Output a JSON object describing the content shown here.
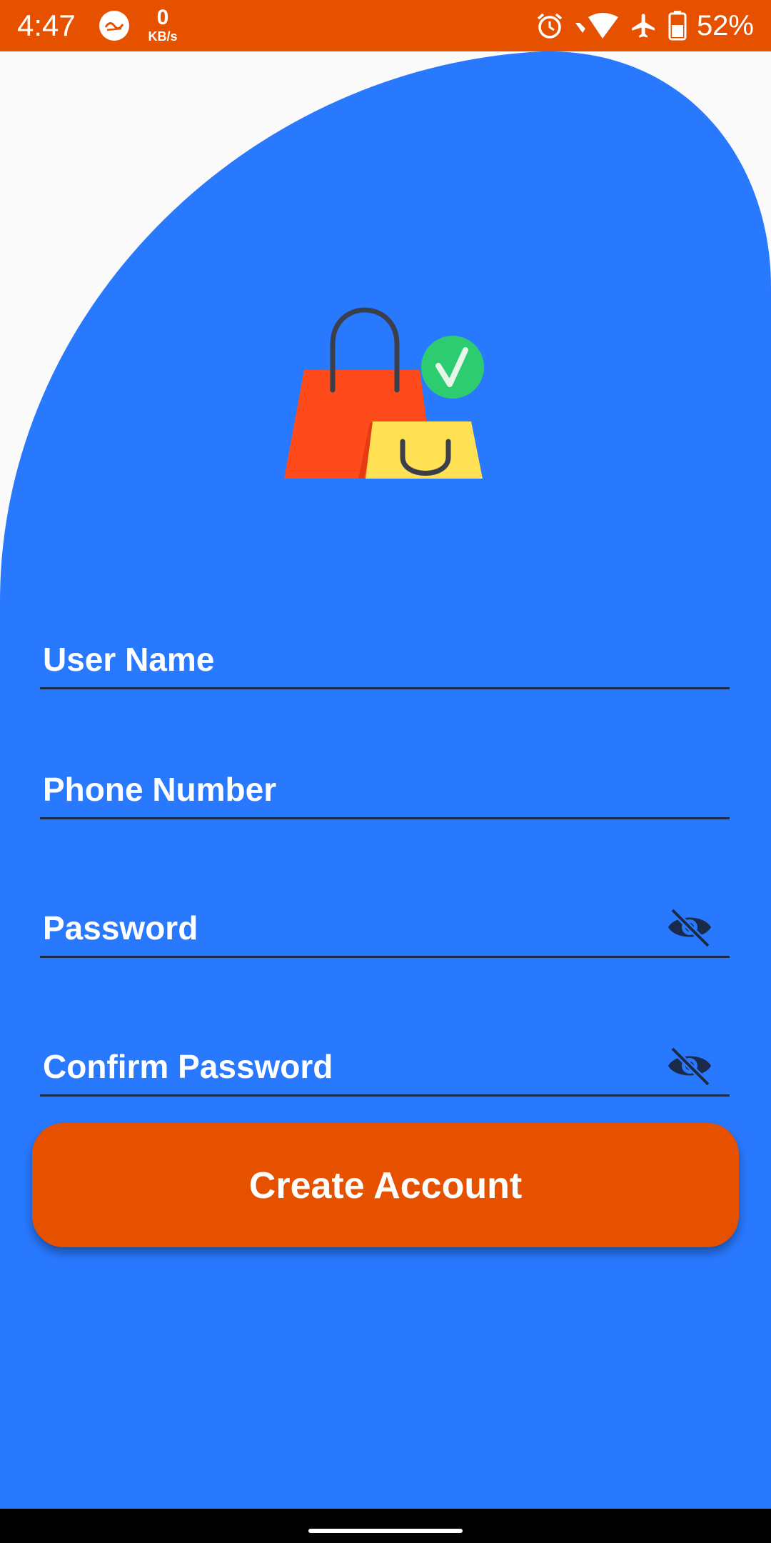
{
  "status_bar": {
    "time": "4:47",
    "net_speed_value": "0",
    "net_speed_unit": "KB/s",
    "battery_percent": "52%",
    "icons": [
      "app-notification-icon",
      "alarm-icon",
      "wifi-icon",
      "airplane-mode-icon",
      "battery-icon"
    ],
    "background": "#E65100"
  },
  "signup_form": {
    "fields": [
      {
        "label": "User Name",
        "type": "text"
      },
      {
        "label": "Phone Number",
        "type": "tel"
      },
      {
        "label": "Password",
        "type": "password",
        "toggle_icon": "visibility-off-icon"
      },
      {
        "label": "Confirm Password",
        "type": "password",
        "toggle_icon": "visibility-off-icon"
      }
    ],
    "submit_label": "Create Account"
  },
  "logo": {
    "icon": "shopping-bag-check-icon",
    "colors": {
      "red_bag": "#FF4A1C",
      "yellow_bag": "#FFE153",
      "check_badge": "#2ECC71",
      "handle": "#3A3F4B"
    }
  },
  "colors": {
    "primary_blue": "#2979FF",
    "accent_orange": "#E65100",
    "background": "#FAFAFA",
    "underline": "#1A2A4A",
    "text": "#FFFFFF"
  }
}
